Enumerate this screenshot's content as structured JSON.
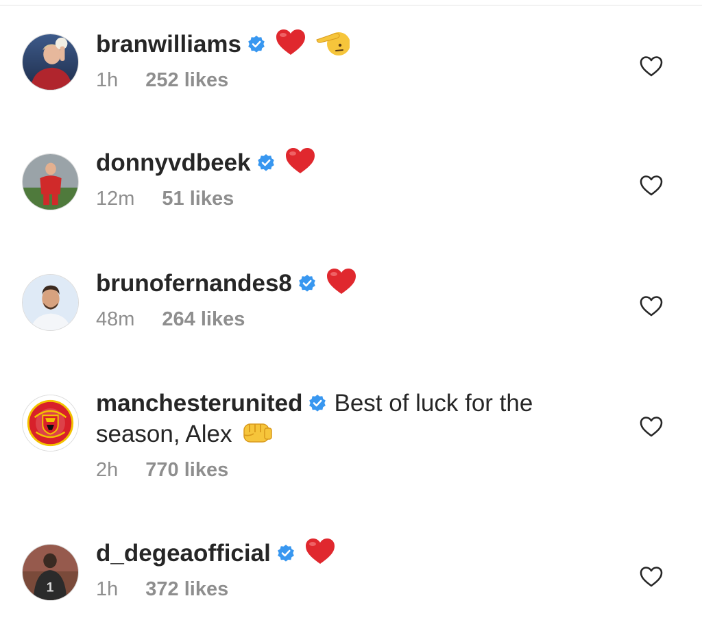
{
  "comments": [
    {
      "username": "branwilliams",
      "verified": true,
      "emojis": [
        "heart",
        "saluting-face"
      ],
      "text": "",
      "time": "1h",
      "likes": "252 likes",
      "avatar": "player-photo-icon"
    },
    {
      "username": "donnyvdbeek",
      "verified": true,
      "emojis": [
        "heart"
      ],
      "text": "",
      "time": "12m",
      "likes": "51 likes",
      "avatar": "player-photo-icon"
    },
    {
      "username": "brunofernandes8",
      "verified": true,
      "emojis": [
        "heart"
      ],
      "text": "",
      "time": "48m",
      "likes": "264 likes",
      "avatar": "player-photo-icon"
    },
    {
      "username": "manchesterunited",
      "verified": true,
      "emojis": [
        "oncoming-fist"
      ],
      "text": "Best of luck for the",
      "text_line2": "season, Alex",
      "time": "2h",
      "likes": "770 likes",
      "avatar": "club-crest-icon"
    },
    {
      "username": "d_degeaofficial",
      "verified": true,
      "emojis": [
        "heart"
      ],
      "text": "",
      "time": "1h",
      "likes": "372 likes",
      "avatar": "player-photo-icon"
    }
  ],
  "colors": {
    "verified_badge": "#3897f0",
    "heart_emoji": "#e0282e",
    "meta_text": "#8e8e8e",
    "primary_text": "#262626"
  }
}
